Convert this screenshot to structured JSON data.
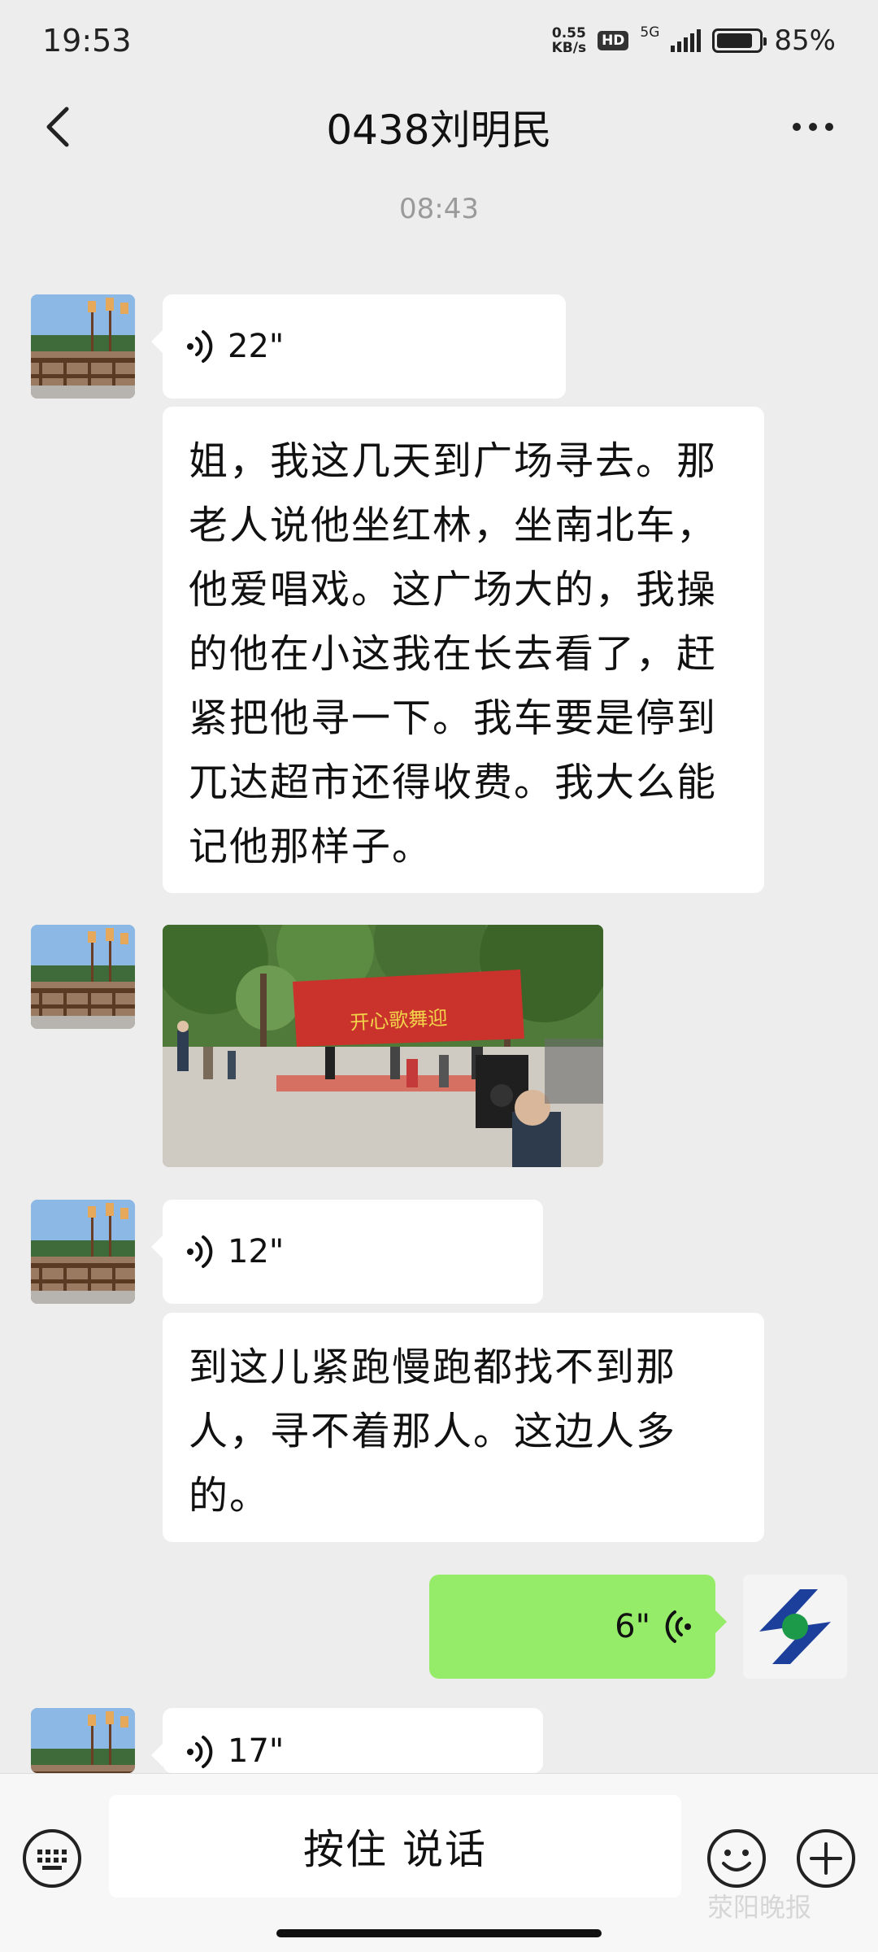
{
  "status_bar": {
    "time": "19:53",
    "net_speed_value": "0.55",
    "net_speed_unit": "KB/s",
    "hd_badge": "HD",
    "signal_label": "5G",
    "battery_percent": "85%",
    "battery_level": 0.85
  },
  "header": {
    "title": "0438刘明民"
  },
  "chat": {
    "timestamp": "08:43",
    "messages": [
      {
        "type": "voice",
        "direction": "received",
        "duration": "22\""
      },
      {
        "type": "text",
        "direction": "received",
        "text": "姐，我这几天到广场寻去。那老人说他坐红林，坐南北车，他爱唱戏。这广场大的，我操的他在小这我在长去看了，赶紧把他寻一下。我车要是停到兀达超市还得收费。我大么能记他那样子。"
      },
      {
        "type": "image",
        "direction": "received",
        "banner_text": "开心歌舞迎"
      },
      {
        "type": "voice",
        "direction": "received",
        "duration": "12\""
      },
      {
        "type": "text",
        "direction": "received",
        "text": "到这儿紧跑慢跑都找不到那人，寻不着那人。这边人多的。"
      },
      {
        "type": "voice",
        "direction": "sent",
        "duration": "6\""
      },
      {
        "type": "voice",
        "direction": "received",
        "duration": "17\""
      }
    ]
  },
  "input_bar": {
    "talk_label": "按住 说话"
  },
  "watermark": "荥阳晚报",
  "colors": {
    "background": "#ededed",
    "sent_bubble": "#95ec69",
    "received_bubble": "#ffffff",
    "timestamp": "#9a9a9a"
  },
  "icons": [
    "back-arrow-icon",
    "more-icon",
    "voice-wave-icon",
    "keyboard-icon",
    "emoji-icon",
    "plus-icon"
  ]
}
